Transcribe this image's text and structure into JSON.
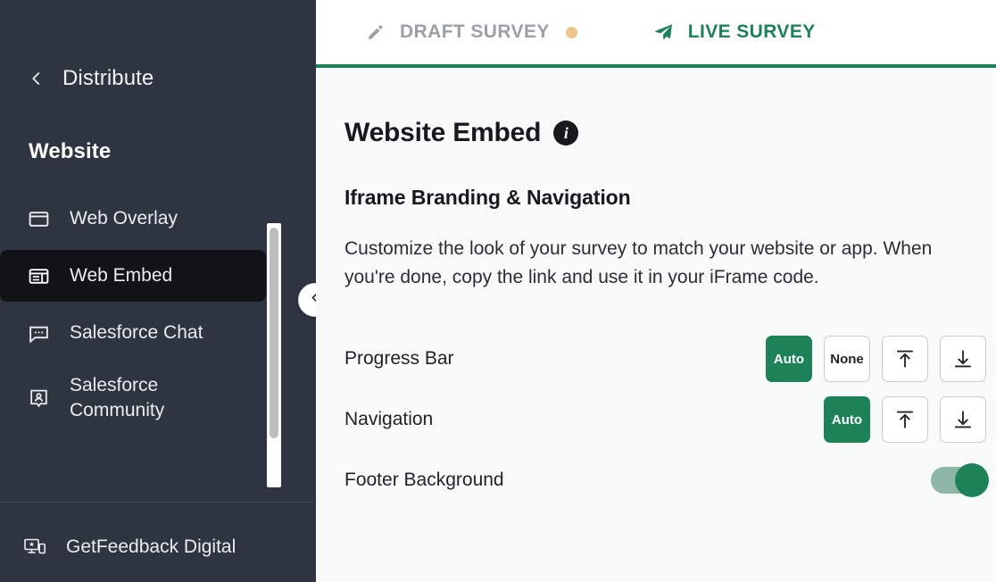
{
  "sidebar": {
    "back_label": "Distribute",
    "section_title": "Website",
    "nav_items": [
      {
        "label": "Web Overlay",
        "icon": "window-icon",
        "active": false
      },
      {
        "label": "Web Embed",
        "icon": "embed-layout-icon",
        "active": true
      },
      {
        "label": "Salesforce Chat",
        "icon": "chat-bubble-icon",
        "active": false
      },
      {
        "label": "Salesforce Community",
        "icon": "person-card-icon",
        "active": false
      }
    ],
    "footer_item": {
      "label": "GetFeedback Digital",
      "icon": "monitor-mobile-icon"
    },
    "collapse_icon": "chevron-left-icon",
    "background_color": "#2e3440",
    "active_item_color": "#111317"
  },
  "tabs": [
    {
      "label": "DRAFT SURVEY",
      "icon": "pencil-icon",
      "state": "inactive",
      "badge_dot": true,
      "color": "#9aa0a6"
    },
    {
      "label": "LIVE SURVEY",
      "icon": "paper-plane-icon",
      "state": "active",
      "badge_dot": false,
      "color": "#1e8259"
    }
  ],
  "main": {
    "page_title": "Website Embed",
    "info_icon": "info-icon",
    "info_glyph": "i",
    "sub_title": "Iframe Branding & Navigation",
    "description": "Customize the look of your survey to match your website or app. When you're done, copy the link and use it in your iFrame code.",
    "options": [
      {
        "label": "Progress Bar",
        "type": "segmented",
        "buttons": [
          {
            "label": "Auto",
            "icon": "",
            "selected": true
          },
          {
            "label": "None",
            "icon": "",
            "selected": false
          },
          {
            "label": "",
            "icon": "align-top-icon",
            "selected": false
          },
          {
            "label": "",
            "icon": "align-bottom-icon",
            "selected": false
          }
        ]
      },
      {
        "label": "Navigation",
        "type": "segmented",
        "buttons": [
          {
            "label": "Auto",
            "icon": "",
            "selected": true
          },
          {
            "label": "",
            "icon": "align-top-icon",
            "selected": false
          },
          {
            "label": "",
            "icon": "align-bottom-icon",
            "selected": false
          }
        ]
      },
      {
        "label": "Footer Background",
        "type": "toggle",
        "value": "on"
      }
    ]
  },
  "theme": {
    "accent_green": "#1e8259",
    "badge_orange": "#edc48b",
    "main_background": "#f8f9f9"
  }
}
